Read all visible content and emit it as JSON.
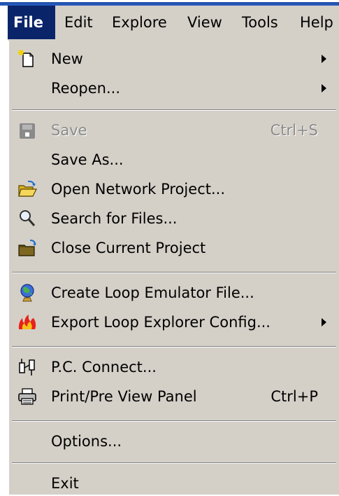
{
  "menubar": {
    "items": [
      {
        "label": "File"
      },
      {
        "label": "Edit"
      },
      {
        "label": "Explore"
      },
      {
        "label": "View"
      },
      {
        "label": "Tools"
      },
      {
        "label": "Help"
      }
    ]
  },
  "file_menu": {
    "items": [
      {
        "label": "New",
        "icon": "new-document-icon",
        "submenu": true
      },
      {
        "label": "Reopen...",
        "submenu": true
      },
      {
        "label": "Save",
        "shortcut": "Ctrl+S",
        "icon": "save-icon",
        "disabled": true
      },
      {
        "label": "Save As..."
      },
      {
        "label": "Open Network Project...",
        "icon": "open-folder-icon"
      },
      {
        "label": "Search for Files...",
        "icon": "magnifier-icon"
      },
      {
        "label": "Close Current Project",
        "icon": "close-folder-icon"
      },
      {
        "label": "Create Loop Emulator File...",
        "icon": "globe-icon"
      },
      {
        "label": "Export Loop Explorer Config...",
        "icon": "fire-icon",
        "submenu": true
      },
      {
        "label": "P.C. Connect...",
        "icon": "connect-icon"
      },
      {
        "label": "Print/Pre View Panel",
        "shortcut": "Ctrl+P",
        "icon": "printer-icon"
      },
      {
        "label": "Options..."
      },
      {
        "label": "Exit"
      }
    ]
  }
}
